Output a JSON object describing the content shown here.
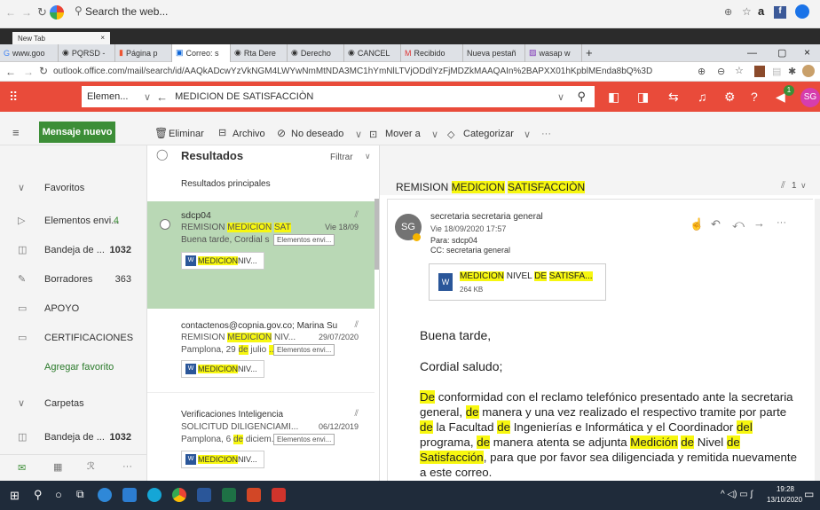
{
  "browser": {
    "search_placeholder": "Search the web...",
    "newtab_label": "New Tab",
    "tabs": [
      "www.goo",
      "PQRSD -",
      "Página p",
      "Correo: s",
      "Rta Dere",
      "Derecho",
      "CANCEL",
      "Recibido",
      "Nueva pestañ",
      "wasap w"
    ],
    "url": "outlook.office.com/mail/search/id/AAQkADcwYzVkNGM4LWYwNmMtNDA3MC1hYmNlLTVjODdlYzFjMDZkMAAQAIn%2BAPXX01hKpblMEnda8bQ%3D"
  },
  "outlook": {
    "scope_label": "Elemen...",
    "search_query": "MEDICION DE SATISFACCIÒN",
    "avatar_initials": "SG",
    "notification_count": "1",
    "accent": "#e94b3a"
  },
  "toolbar": {
    "new_message": "Mensaje nuevo",
    "delete": "Eliminar",
    "archive": "Archivo",
    "junk": "No deseado",
    "move": "Mover a",
    "categorize": "Categorizar"
  },
  "sidebar": {
    "favorites": "Favoritos",
    "items": [
      {
        "label": "Elementos envi...",
        "count": "4"
      },
      {
        "label": "Bandeja de ...",
        "count": "1032"
      },
      {
        "label": "Borradores",
        "count": "363"
      },
      {
        "label": "APOYO",
        "count": ""
      },
      {
        "label": "CERTIFICACIONES",
        "count": ""
      }
    ],
    "add_favorite": "Agregar favorito",
    "folders": "Carpetas",
    "folder_items": [
      {
        "label": "Bandeja de ...",
        "count": "1032"
      }
    ]
  },
  "list": {
    "title": "Resultados",
    "filter": "Filtrar",
    "section": "Resultados principales",
    "messages": [
      {
        "from": "sdcp04",
        "subject_pre": "REMISION ",
        "subject_hl": "MEDICION",
        "subject_mid": " ",
        "subject_hl2": "SAT",
        "date": "Vie 18/09",
        "preview": "Buena tarde, Cordial s...",
        "chip": "Elementos envi...",
        "att_hl": "MEDICION",
        "att_rest": " NIV..."
      },
      {
        "from": "contactenos@copnia.gov.co; Marina Su",
        "subject_pre": "REMISION ",
        "subject_hl": "MEDICION",
        "subject_mid": " NIV...",
        "subject_hl2": "",
        "date": "29/07/2020",
        "preview_pre": "Pamplona, 29 ",
        "preview_hl": "de",
        "preview_post": " julio ",
        "preview_hl2": "...",
        "chip": "Elementos envi...",
        "att_hl": "MEDICION",
        "att_rest": " NIV..."
      },
      {
        "from": "Verificaciones Inteligencia",
        "subject_pre": "SOLICITUD DILIGENCIAMI...",
        "date": "06/12/2019",
        "preview_pre": "Pamplona, 6 ",
        "preview_hl": "de",
        "preview_post": " diciem...",
        "chip": "Elementos envi...",
        "att_hl": "MEDICION",
        "att_rest": " NIV..."
      }
    ]
  },
  "reading": {
    "subject_pre": "REMISION ",
    "subject_hl1": "MEDICION",
    "subject_hl2": "SATISFACCIÒN",
    "attach_count": "1",
    "sender": "secretaria secretaria general",
    "date": "Vie 18/09/2020 17:57",
    "to": "Para: sdcp04",
    "cc": "CC: secretaria general",
    "attachment_hl": "MEDICION",
    "attachment_mid": " NIVEL ",
    "attachment_hl2": "DE",
    "attachment_sp": " ",
    "attachment_hl3": "SATISFA...",
    "attachment_size": "264 KB",
    "greeting": "Buena tarde,",
    "salute": "Cordial saludo;",
    "body": [
      {
        "t": "De",
        "h": true
      },
      {
        "t": " conformidad con el reclamo telefónico presentado ante la secretaria general, ",
        "h": false
      },
      {
        "t": "de",
        "h": true
      },
      {
        "t": " manera y una vez realizado el respectivo tramite por parte ",
        "h": false
      },
      {
        "t": "de",
        "h": true
      },
      {
        "t": " la Facultad ",
        "h": false
      },
      {
        "t": "de",
        "h": true
      },
      {
        "t": " Ingenierías e Informática y el Coordinador ",
        "h": false
      },
      {
        "t": "del",
        "h": true
      },
      {
        "t": " programa, ",
        "h": false
      },
      {
        "t": "de",
        "h": true
      },
      {
        "t": " manera atenta se adjunta ",
        "h": false
      },
      {
        "t": "Medición",
        "h": true
      },
      {
        "t": " ",
        "h": false
      },
      {
        "t": "de",
        "h": true
      },
      {
        "t": "  Nivel ",
        "h": false
      },
      {
        "t": "de",
        "h": true
      },
      {
        "t": " ",
        "h": false
      },
      {
        "t": "Satisfacción",
        "h": true
      },
      {
        "t": ", para que por favor sea diligenciada  y remitida nuevamente a este correo.",
        "h": false
      }
    ]
  },
  "taskbar": {
    "time": "19:28",
    "date": "13/10/2020"
  }
}
